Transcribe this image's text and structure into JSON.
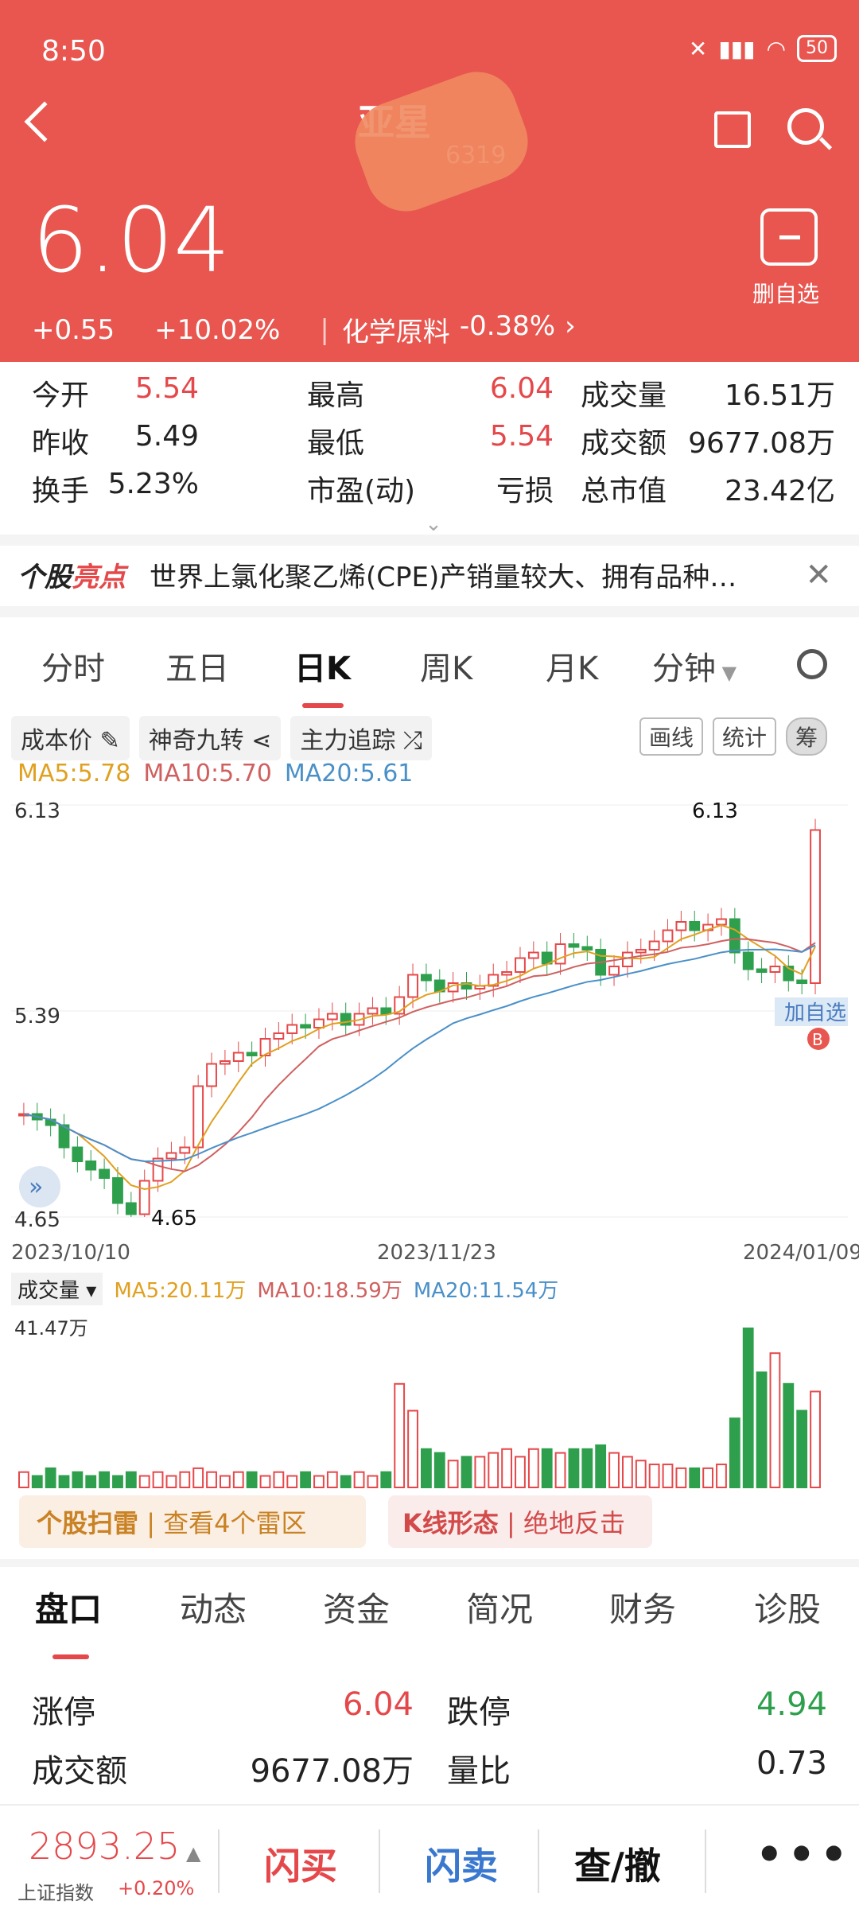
{
  "status_bar": {
    "time": "8:50",
    "battery": "50"
  },
  "header": {
    "title": "亚星",
    "code": "6319",
    "price": "6.04",
    "change": "+0.55",
    "change_pct": "+10.02%",
    "sector": "化学原料",
    "sector_pct": "-0.38%",
    "remove_watch_label": "删自选"
  },
  "quotes": {
    "rows": [
      [
        {
          "label": "今开",
          "value": "5.54",
          "color": "red"
        },
        {
          "label": "最高",
          "value": "6.04",
          "color": "red"
        },
        {
          "label": "成交量",
          "value": "16.51万"
        }
      ],
      [
        {
          "label": "昨收",
          "value": "5.49"
        },
        {
          "label": "最低",
          "value": "5.54",
          "color": "red"
        },
        {
          "label": "成交额",
          "value": "9677.08万"
        }
      ],
      [
        {
          "label": "换手",
          "value": "5.23%"
        },
        {
          "label": "市盈(动)",
          "value": "亏损"
        },
        {
          "label": "总市值",
          "value": "23.42亿"
        }
      ]
    ]
  },
  "highlight": {
    "tag_a": "个股",
    "tag_b": "亮点",
    "text": "世界上氯化聚乙烯(CPE)产销量较大、拥有品种…"
  },
  "chart_tabs": [
    "分时",
    "五日",
    "日K",
    "周K",
    "月K",
    "分钟"
  ],
  "tools": [
    "成本价",
    "神奇九转",
    "主力追踪"
  ],
  "tool_pills": [
    "画线",
    "统计",
    "筹"
  ],
  "ma": {
    "ma5": "MA5:5.78",
    "ma10": "MA10:5.70",
    "ma20": "MA20:5.61"
  },
  "chart_labels": {
    "y_top": "6.13",
    "y_mid": "5.39",
    "y_bottom": "4.65",
    "high_mark": "6.13",
    "low_mark": "4.65",
    "date_start": "2023/10/10",
    "date_mid": "2023/11/23",
    "date_end": "2024/01/09",
    "add_watch": "加自选",
    "b_mark": "B"
  },
  "volume": {
    "label": "成交量",
    "ma5": "MA5:20.11万",
    "ma10": "MA10:18.59万",
    "ma20": "MA20:11.54万",
    "max": "41.47万"
  },
  "signals": {
    "scan": "个股扫雷",
    "scan_detail": "查看4个雷区",
    "kline": "K线形态",
    "kline_detail": "绝地反击"
  },
  "bottom_tabs": [
    "盘口",
    "动态",
    "资金",
    "简况",
    "财务",
    "诊股"
  ],
  "pankou": {
    "limit_up_label": "涨停",
    "limit_up": "6.04",
    "limit_down_label": "跌停",
    "limit_down": "4.94",
    "amount_label": "成交额",
    "amount": "9677.08万",
    "ratio_label": "量比",
    "ratio": "0.73"
  },
  "footer": {
    "index_value": "2893.25",
    "index_name": "上证指数",
    "index_chg": "+0.20%",
    "buy": "闪买",
    "sell": "闪卖",
    "query": "查/撤",
    "more": "•••"
  },
  "colors": {
    "header": "#e8564f",
    "up": "#e5484a",
    "down": "#2e9f4c",
    "ma5": "#e0a020",
    "ma10": "#d06060",
    "ma20": "#4a90c8"
  },
  "chart_data": {
    "type": "candlestick",
    "x_range": [
      "2023/10/10",
      "2024/01/09"
    ],
    "ylim": [
      4.65,
      6.13
    ],
    "close": [
      5.02,
      5.0,
      4.98,
      4.9,
      4.85,
      4.82,
      4.79,
      4.7,
      4.66,
      4.78,
      4.86,
      4.88,
      4.9,
      5.12,
      5.2,
      5.21,
      5.24,
      5.23,
      5.29,
      5.31,
      5.34,
      5.33,
      5.36,
      5.38,
      5.34,
      5.38,
      5.4,
      5.38,
      5.44,
      5.52,
      5.5,
      5.46,
      5.49,
      5.47,
      5.48,
      5.52,
      5.53,
      5.58,
      5.6,
      5.56,
      5.63,
      5.62,
      5.61,
      5.52,
      5.55,
      5.6,
      5.61,
      5.64,
      5.68,
      5.71,
      5.68,
      5.7,
      5.72,
      5.6,
      5.54,
      5.53,
      5.55,
      5.5,
      5.49,
      6.04
    ],
    "volume_wan": [
      4,
      3,
      5,
      3,
      4,
      3,
      4,
      3,
      4,
      3,
      4,
      3,
      4,
      5,
      4,
      3,
      4,
      4,
      3,
      4,
      3,
      4,
      3,
      4,
      3,
      4,
      3,
      4,
      27,
      20,
      10,
      9,
      7,
      8,
      8,
      9,
      10,
      8,
      10,
      10,
      9,
      10,
      10,
      11,
      9,
      8,
      7,
      6,
      6,
      5,
      5,
      5,
      6,
      18,
      41.47,
      30,
      35,
      27,
      20,
      25
    ]
  }
}
